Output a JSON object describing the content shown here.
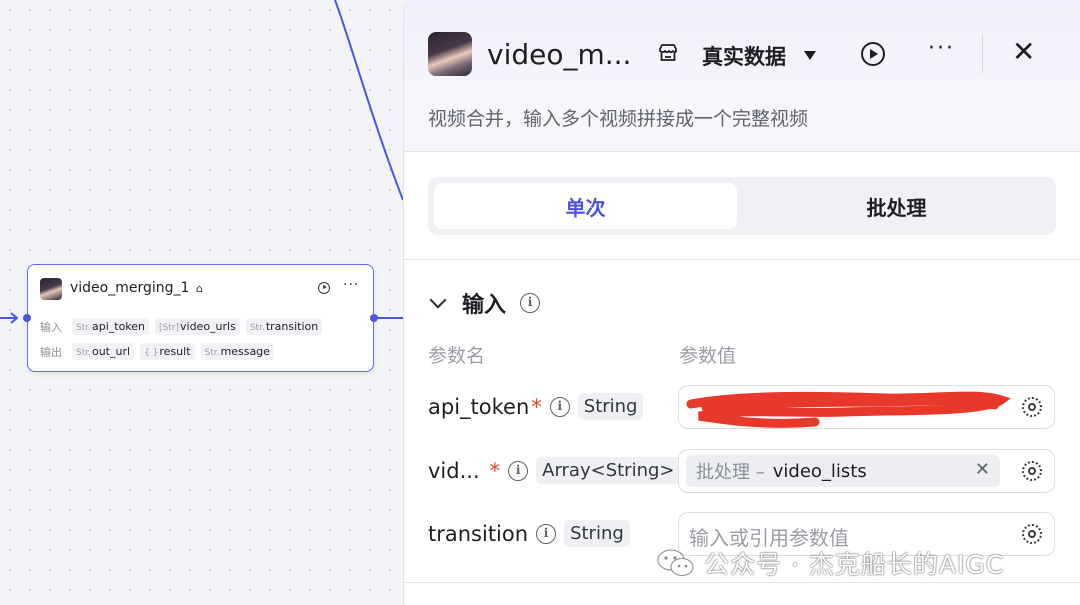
{
  "node": {
    "title": "video_merging_1",
    "input_label": "输入",
    "output_label": "输出",
    "inputs": [
      {
        "type": "Str.",
        "name": "api_token"
      },
      {
        "type": "[Str]",
        "name": "video_urls"
      },
      {
        "type": "Str.",
        "name": "transition"
      }
    ],
    "outputs": [
      {
        "type": "Str.",
        "name": "out_url"
      },
      {
        "type": "{ }",
        "name": "result"
      },
      {
        "type": "Str.",
        "name": "message"
      }
    ]
  },
  "panel": {
    "title": "video_m...",
    "mode_label": "真实数据",
    "description": "视频合并，输入多个视频拼接成一个完整视频",
    "tabs": [
      {
        "label": "单次",
        "active": true
      },
      {
        "label": "批处理",
        "active": false
      }
    ],
    "section_title": "输入",
    "column_name": "参数名",
    "column_value": "参数值",
    "params": [
      {
        "name": "api_token",
        "required": true,
        "type": "String",
        "value": ""
      },
      {
        "name": "vid...",
        "required": true,
        "type": "Array<String>",
        "ref_prefix": "批处理 –",
        "ref_value": "video_lists"
      },
      {
        "name": "transition",
        "required": false,
        "type": "String",
        "placeholder": "输入或引用参数值"
      }
    ]
  },
  "watermark": "公众号 · 杰克船长的AIGC",
  "colors": {
    "accent": "#4d53e0",
    "edge": "#4a56e6",
    "required": "#e0452a",
    "redaction": "#e8382a"
  }
}
